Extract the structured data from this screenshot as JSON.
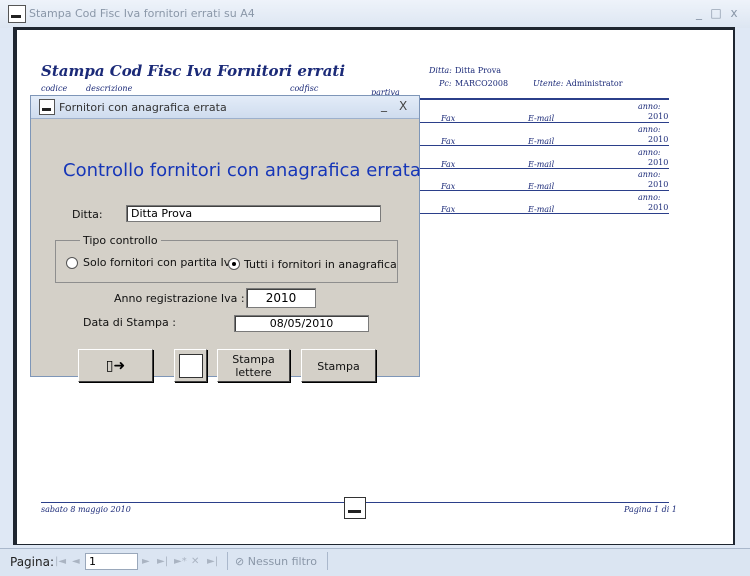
{
  "window": {
    "title": "Stampa Cod Fisc Iva fornitori errati su A4",
    "minimize": "_",
    "maximize": "□",
    "close": "x"
  },
  "report": {
    "title": "Stampa Cod Fisc Iva Fornitori errati",
    "headers": {
      "codice": "codice",
      "descrizione": "descrizione",
      "codfisc": "codfisc",
      "partiva": "partiva"
    },
    "ditta_label": "Ditta:",
    "ditta_value": "Ditta Prova",
    "pc_label": "Pc:",
    "pc_value": "MARCO2008",
    "utente_label": "Utente:",
    "utente_value": "Administrator",
    "rows": [
      {
        "anno_label": "anno:",
        "anno": "2010",
        "fax": "Fax",
        "email": "E-mail"
      },
      {
        "anno_label": "anno:",
        "anno": "2010",
        "fax": "Fax",
        "email": "E-mail"
      },
      {
        "anno_label": "anno:",
        "anno": "2010",
        "fax": "Fax",
        "email": "E-mail"
      },
      {
        "anno_label": "anno:",
        "anno": "2010",
        "fax": "Fax",
        "email": "E-mail"
      },
      {
        "anno_label": "anno:",
        "anno": "2010",
        "fax": "Fax",
        "email": "E-mail"
      }
    ],
    "footer_date": "sabato 8 maggio 2010",
    "footer_page": "Pagina 1 di 1"
  },
  "dialog": {
    "title": "Fornitori con anagrafica errata",
    "minimize": "_",
    "close": "X",
    "heading": "Controllo fornitori con anagrafica errata",
    "ditta_label": "Ditta:",
    "ditta_value": "Ditta Prova",
    "group_label": "Tipo controllo",
    "option1": "Solo fornitori con partita Iva",
    "option2": "Tutti i fornitori in anagrafica",
    "selected_option": "option2",
    "anno_label": "Anno registrazione Iva :",
    "anno_value": "2010",
    "data_label": "Data di Stampa :",
    "data_value": "08/05/2010",
    "btn_exit_icon": "exit-door-icon",
    "btn_preview_icon": "app-logo-icon",
    "btn_lettere": "Stampa lettere",
    "btn_stampa": "Stampa"
  },
  "status": {
    "pagina_label": "Pagina:",
    "page_value": "1",
    "filter_label": "Nessun filtro",
    "filter_icon": "filter-icon"
  }
}
